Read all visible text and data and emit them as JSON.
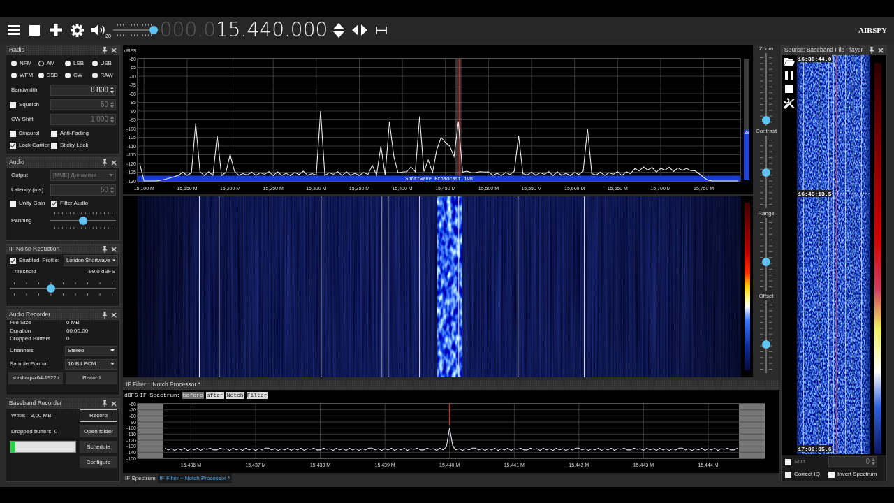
{
  "toolbar": {
    "volume": {
      "level": 1,
      "reading": "20"
    },
    "frequency_prefix": "000.0",
    "frequency": "15.440.000",
    "logo": "AIRSPY"
  },
  "radio": {
    "title": "Radio",
    "modes": [
      {
        "label": "NFM",
        "selected": false
      },
      {
        "label": "AM",
        "selected": true
      },
      {
        "label": "LSB",
        "selected": false
      },
      {
        "label": "USB",
        "selected": false
      },
      {
        "label": "WFM",
        "selected": false
      },
      {
        "label": "DSB",
        "selected": false
      },
      {
        "label": "CW",
        "selected": false
      },
      {
        "label": "RAW",
        "selected": false
      }
    ],
    "bandwidth": {
      "label": "Bandwidth",
      "value": "8 808",
      "disabled": false
    },
    "squelch": {
      "label": "Squelch",
      "checked": false,
      "value": "50",
      "disabled": true
    },
    "cw_shift": {
      "label": "CW Shift",
      "value": "1 000",
      "disabled": true
    },
    "options": [
      {
        "label": "Binaural",
        "checked": false
      },
      {
        "label": "Anti-Fading",
        "checked": false
      },
      {
        "label": "Lock Carrier",
        "checked": true
      },
      {
        "label": "Sticky Lock",
        "checked": false
      }
    ]
  },
  "audio": {
    "title": "Audio",
    "output": {
      "label": "Output",
      "value": "[MME] Динамики",
      "disabled": true
    },
    "latency": {
      "label": "Latency (ms)",
      "value": "50",
      "disabled": true
    },
    "options": [
      {
        "label": "Unity Gain",
        "checked": false
      },
      {
        "label": "Filter Audio",
        "checked": true
      }
    ],
    "panning": {
      "label": "Panning",
      "level": 0.5
    }
  },
  "if_noise_reduction": {
    "title": "IF Noise Reduction",
    "enabled": {
      "label": "Enabled",
      "checked": true
    },
    "profile": {
      "label": "Profile:",
      "value": "London Shortwave"
    },
    "threshold": {
      "label": "Threshold",
      "reading": "-99,0 dBFS",
      "level": 0.38
    }
  },
  "audio_recorder": {
    "title": "Audio Recorder",
    "stats": [
      {
        "label": "File Size",
        "value": "0 MB"
      },
      {
        "label": "Duration",
        "value": "00:00:00"
      },
      {
        "label": "Dropped Buffers",
        "value": "0"
      }
    ],
    "selects": [
      {
        "label": "Channels",
        "value": "Stereo"
      },
      {
        "label": "Sample Format",
        "value": "16 Bit PCM"
      }
    ],
    "buttons": [
      "sdrsharp-x64-1922b",
      "Record"
    ]
  },
  "baseband_recorder": {
    "title": "Baseband Recorder",
    "write": {
      "label": "Write:",
      "value": "3,00 MB"
    },
    "dropped": "Dropped buffers: 0",
    "progress": {
      "level": 0.07
    },
    "buttons": [
      {
        "label": "Record",
        "focused": true
      },
      {
        "label": "Open folder",
        "focused": false
      },
      {
        "label": "Schedule",
        "focused": false
      },
      {
        "label": "Configure",
        "focused": false
      }
    ]
  },
  "spectrum": {
    "chart_data": {
      "type": "line",
      "ylabel": "dBFS",
      "color": "#ececec",
      "grid": true,
      "ylim": [
        -130,
        -60
      ],
      "yticks": [
        -60,
        -65,
        -70,
        -75,
        -80,
        -85,
        -90,
        -95,
        -100,
        -105,
        -110,
        -115,
        -120,
        -125,
        -130
      ],
      "categories": [
        null,
        "15,100 M",
        null,
        null,
        null,
        null,
        null,
        null,
        null,
        null,
        null,
        "15,150 M",
        null,
        null,
        null,
        null,
        null,
        null,
        null,
        null,
        null,
        "15,200 M",
        null,
        null,
        null,
        null,
        null,
        null,
        null,
        null,
        null,
        "15,250 M",
        null,
        null,
        null,
        null,
        null,
        null,
        null,
        null,
        null,
        "15,300 M",
        null,
        null,
        null,
        null,
        null,
        null,
        null,
        null,
        null,
        "15,350 M",
        null,
        null,
        null,
        null,
        null,
        null,
        null,
        null,
        null,
        "15,400 M",
        null,
        null,
        null,
        null,
        null,
        null,
        null,
        null,
        null,
        "15,450 M",
        null,
        null,
        null,
        null,
        null,
        null,
        null,
        null,
        null,
        "15,500 M",
        null,
        null,
        null,
        null,
        null,
        null,
        null,
        null,
        null,
        "15,550 M",
        null,
        null,
        null,
        null,
        null,
        null,
        null,
        null,
        null,
        "15,600 M",
        null,
        null,
        null,
        null,
        null,
        null,
        null,
        null,
        null,
        "15,650 M",
        null,
        null,
        null,
        null,
        null,
        null,
        null,
        null,
        null,
        "15,700 M",
        null,
        null,
        null,
        null,
        null,
        null,
        null,
        null,
        null,
        "15,750 M",
        null,
        null,
        null,
        null,
        null,
        null,
        null,
        null
      ],
      "values": [
        -120,
        -130,
        -130,
        -130,
        -130,
        -129.5,
        -129,
        -128.3,
        -127.6,
        -126.8,
        -125,
        -126.8,
        -125.3,
        -97,
        -124.7,
        -126.9,
        -124.8,
        -126.8,
        -104,
        -126.9,
        -125.1,
        -115,
        -124.4,
        -126.7,
        -125.8,
        -126.6,
        -125,
        -126.8,
        -125.3,
        -126.2,
        -124.7,
        -126.9,
        -124.8,
        -126.8,
        -125.6,
        -126.9,
        -125.1,
        -126.3,
        -124.4,
        -126.7,
        -125.8,
        -126.6,
        -90,
        -126.8,
        -125.3,
        -126.2,
        -124.7,
        -126.9,
        -124.8,
        -126.8,
        -125.6,
        -126.9,
        -125.1,
        -126.3,
        -121,
        -126.7,
        -110,
        -126.6,
        -96,
        -116,
        -125.3,
        -124.9,
        -124.7,
        -122,
        -124.8,
        -93,
        -124.6,
        -118,
        -125.1,
        -112,
        -105,
        -108,
        -110,
        -116,
        -96,
        -125,
        -124.4,
        -125.3,
        -125.2,
        -124.7,
        -124.9,
        -124.8,
        -126.8,
        -125.6,
        -126.9,
        -125.1,
        -126.3,
        -124.4,
        -104,
        -125.8,
        -126.6,
        -125,
        -126.8,
        -125.3,
        -126.2,
        -124.7,
        -126.9,
        -124.8,
        -126.8,
        -125.6,
        -126.9,
        -125.1,
        -126.3,
        -124.4,
        -100,
        -125.8,
        -126.6,
        -125,
        -126.8,
        -125.3,
        -126.2,
        -124.7,
        -126.9,
        -124.8,
        -125.8,
        -122.9,
        -124.3,
        -122,
        -123.7,
        -122.3,
        -124.9,
        -122.8,
        -123.8,
        -122.2,
        -124.6,
        -122.5,
        -123.9,
        -122.8,
        -124.1,
        -124.2,
        -126,
        -128,
        -129.6,
        -130,
        -130,
        -130,
        -130,
        -130,
        -130,
        -130
      ],
      "bands": [
        {
          "axis": "y",
          "from": -130,
          "to": -127,
          "label": "Shortwave Broadcast 19m",
          "color": "#1a3ad4"
        }
      ]
    },
    "meter": {
      "reading": "39",
      "level": 0.42
    }
  },
  "waterfall_controls": [
    {
      "label": "Zoom",
      "level": 0.02
    },
    {
      "label": "Contrast",
      "level": 0.49
    },
    {
      "label": "Range",
      "level": 0.38
    },
    {
      "label": "Offset",
      "level": 0.38
    }
  ],
  "if_processor": {
    "title": "IF Filter + Notch Processor *",
    "views": [
      {
        "label": "before",
        "selected": true
      },
      {
        "label": "after",
        "selected": false
      },
      {
        "label": "Notch",
        "selected": false
      },
      {
        "label": "Filter",
        "selected": false
      }
    ],
    "chart_data": {
      "type": "line",
      "title": "IF Spectrum:",
      "ylabel": "dBFS",
      "color": "#e6e6ee",
      "grid": true,
      "ylim": [
        -150,
        -60
      ],
      "yticks": [
        -60,
        -70,
        -80,
        -90,
        -100,
        -110,
        -120,
        -130,
        -140,
        -150
      ],
      "categories": [
        null,
        null,
        null,
        null,
        null,
        null,
        null,
        null,
        null,
        null,
        null,
        null,
        null,
        null,
        null,
        null,
        "15,436 M",
        null,
        null,
        null,
        null,
        null,
        null,
        null,
        null,
        null,
        null,
        null,
        null,
        null,
        null,
        null,
        null,
        null,
        null,
        null,
        "15,437 M",
        null,
        null,
        null,
        null,
        null,
        null,
        null,
        null,
        null,
        null,
        null,
        null,
        null,
        null,
        null,
        null,
        null,
        null,
        null,
        "15,438 M",
        null,
        null,
        null,
        null,
        null,
        null,
        null,
        null,
        null,
        null,
        null,
        null,
        null,
        null,
        null,
        null,
        null,
        null,
        null,
        "15,439 M",
        null,
        null,
        null,
        null,
        null,
        null,
        null,
        null,
        null,
        null,
        null,
        null,
        null,
        null,
        null,
        null,
        null,
        null,
        null,
        "15,440 M",
        null,
        null,
        null,
        null,
        null,
        null,
        null,
        null,
        null,
        null,
        null,
        null,
        null,
        null,
        null,
        null,
        null,
        null,
        null,
        "15,441 M",
        null,
        null,
        null,
        null,
        null,
        null,
        null,
        null,
        null,
        null,
        null,
        null,
        null,
        null,
        null,
        null,
        null,
        null,
        null,
        "15,442 M",
        null,
        null,
        null,
        null,
        null,
        null,
        null,
        null,
        null,
        null,
        null,
        null,
        null,
        null,
        null,
        null,
        null,
        null,
        null,
        "15,443 M",
        null,
        null,
        null,
        null,
        null,
        null,
        null,
        null,
        null,
        null,
        null,
        null,
        null,
        null,
        null,
        null,
        null,
        null,
        null,
        "15,444 M",
        null,
        null,
        null,
        null,
        null,
        null,
        null,
        null,
        null,
        null,
        null,
        null,
        null,
        null,
        null,
        null,
        null
      ],
      "values": [
        null,
        null,
        null,
        null,
        null,
        null,
        null,
        null,
        -133,
        -136,
        -134,
        -137,
        -134,
        -136,
        -133,
        -137,
        -134,
        -136,
        -133,
        -137,
        -134,
        -135,
        -133,
        -136,
        -136,
        -133,
        -135,
        -134,
        -137,
        -133,
        -136,
        -134,
        -137,
        -133,
        -136,
        -134,
        -137,
        -134,
        -136,
        -133,
        -133,
        -136,
        -134,
        -137,
        -134,
        -136,
        -133,
        -137,
        -134,
        -136,
        -133,
        -137,
        -134,
        -135,
        -133,
        -136,
        -136,
        -133,
        -135,
        -134,
        -137,
        -133,
        -136,
        -134,
        -137,
        -133,
        -136,
        -134,
        -137,
        -134,
        -136,
        -133,
        -133,
        -136,
        -134,
        -137,
        -134,
        -136,
        -133,
        -137,
        -134,
        -136,
        -133,
        -137,
        -134,
        -135,
        -133,
        -136,
        -136,
        -133,
        -135,
        -134,
        -137,
        -133,
        -136,
        -131,
        -100,
        -130,
        -136,
        -134,
        -137,
        -134,
        -136,
        -133,
        -133,
        -136,
        -134,
        -137,
        -134,
        -136,
        -133,
        -137,
        -134,
        -136,
        -133,
        -137,
        -134,
        -135,
        -133,
        -136,
        -136,
        -133,
        -135,
        -134,
        -137,
        -133,
        -136,
        -134,
        -137,
        -133,
        -136,
        -134,
        -137,
        -134,
        -136,
        -133,
        -133,
        -136,
        -134,
        -137,
        -134,
        -136,
        -133,
        -137,
        -134,
        -136,
        -133,
        -137,
        -134,
        -135,
        -133,
        -136,
        -136,
        -133,
        -135,
        -134,
        -137,
        -133,
        -136,
        -134,
        -137,
        -133,
        -136,
        -134,
        -137,
        -134,
        -136,
        -133,
        -133,
        -136,
        -134,
        -137,
        -134,
        -136,
        -133,
        -137,
        -134,
        -136,
        -133,
        -137,
        -134,
        -135,
        -133,
        -136,
        -136,
        -133,
        null,
        null,
        null,
        null,
        null,
        null,
        null,
        null
      ]
    }
  },
  "bottom_tabs": [
    {
      "label": "IF Spectrum",
      "selected": false
    },
    {
      "label": "IF Filter + Notch Processor *",
      "selected": true
    }
  ],
  "source": {
    "title": "Source: Baseband File Player",
    "timestamps": [
      "16:36:44.0",
      "16:45:13.5",
      "17:00:35.6"
    ],
    "shift": {
      "label": "Shift",
      "checked": false,
      "value": "0",
      "disabled": true
    },
    "options": [
      {
        "label": "Correct IQ",
        "checked": false
      },
      {
        "label": "Invert Spectrum",
        "checked": false
      }
    ]
  }
}
